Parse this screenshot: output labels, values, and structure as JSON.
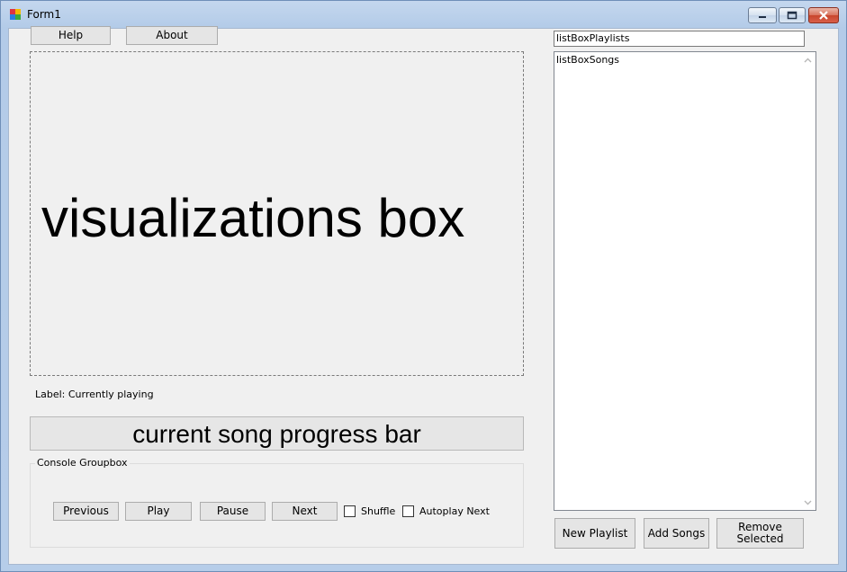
{
  "window": {
    "title": "Form1",
    "controls": {
      "minimize": "minimize-icon",
      "maximize": "maximize-icon",
      "close": "close-icon"
    }
  },
  "toolbar": {
    "help_label": "Help",
    "about_label": "About"
  },
  "visualization": {
    "text": "visualizations box"
  },
  "status": {
    "currently_playing": "Label: Currently playing"
  },
  "progress": {
    "label": "current song progress bar",
    "value": 0
  },
  "console": {
    "title": "Console Groupbox",
    "previous_label": "Previous",
    "play_label": "Play",
    "pause_label": "Pause",
    "next_label": "Next",
    "shuffle_label": "Shuffle",
    "shuffle_checked": false,
    "autoplay_label": "Autoplay Next",
    "autoplay_checked": false
  },
  "playlists": {
    "value": "listBoxPlaylists"
  },
  "songs": {
    "items": [
      "listBoxSongs"
    ]
  },
  "actions": {
    "new_playlist_label": "New Playlist",
    "add_songs_label": "Add Songs",
    "remove_selected_label": "Remove Selected"
  },
  "colors": {
    "progress_fill": "#06b025",
    "titlebar": "#b9cfe9"
  }
}
